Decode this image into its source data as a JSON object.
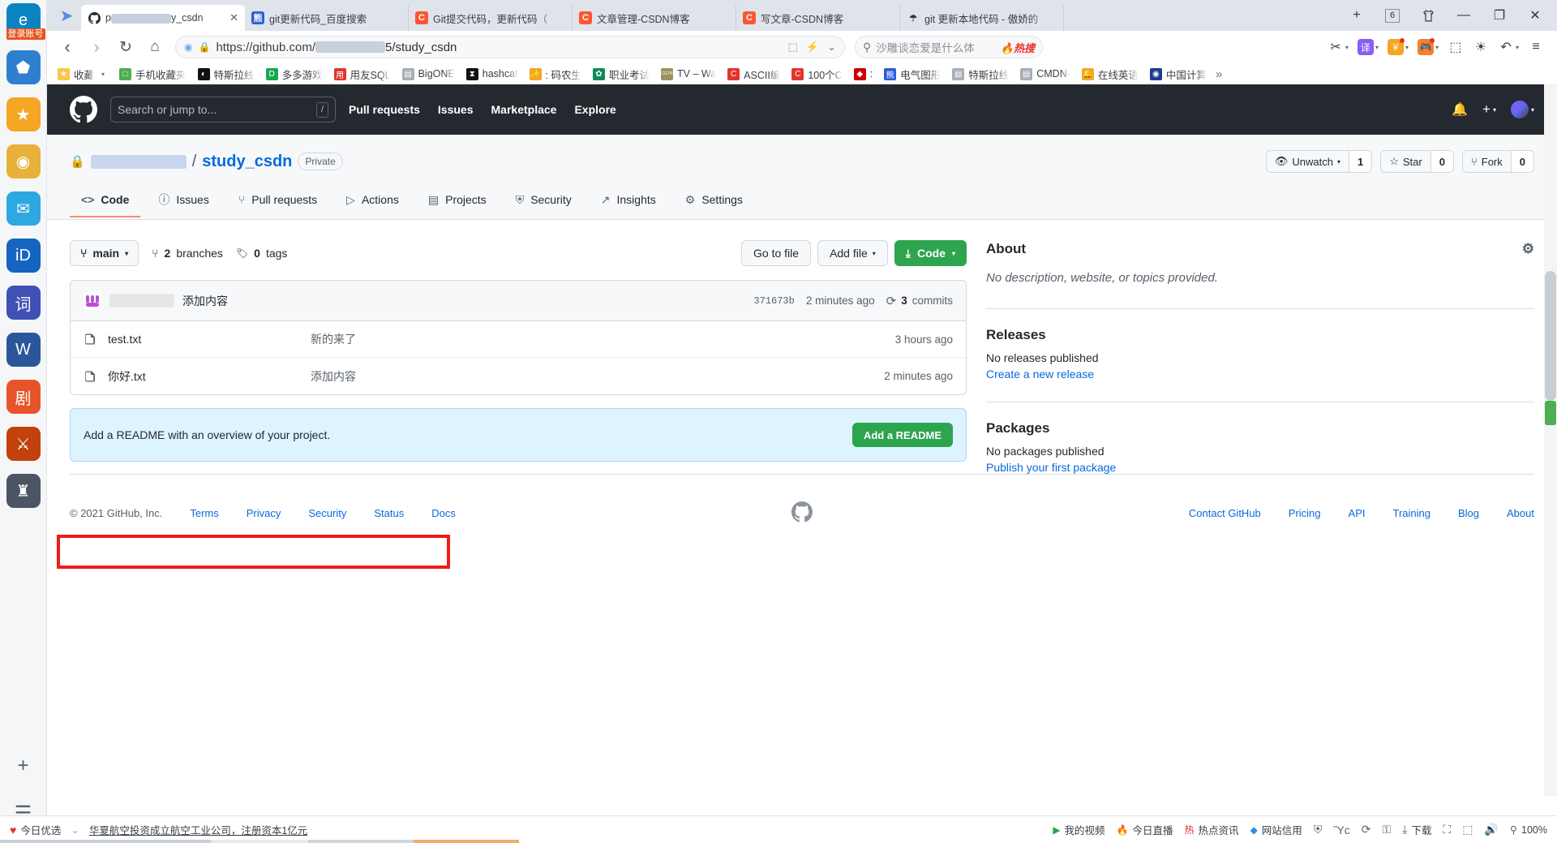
{
  "dock": {
    "items": [
      {
        "name": "ie-browser",
        "glyph": "e",
        "color": "#0a84c1",
        "badge": "登录账号"
      },
      {
        "name": "app-blue-doc",
        "glyph": "⬟",
        "color": "#2f7fd1",
        "badge": ""
      },
      {
        "name": "favorites-star",
        "glyph": "★",
        "color": "#f5a623",
        "badge": ""
      },
      {
        "name": "app-eye",
        "glyph": "◉",
        "color": "#e8b13a",
        "badge": ""
      },
      {
        "name": "mail-app",
        "glyph": "✉",
        "color": "#2da8e0",
        "badge": ""
      },
      {
        "name": "app-id-card",
        "glyph": "iD",
        "color": "#1565c0",
        "badge": ""
      },
      {
        "name": "app-dictionary",
        "glyph": "词",
        "color": "#3f51b5",
        "badge": ""
      },
      {
        "name": "word-app",
        "glyph": "W",
        "color": "#2b579a",
        "badge": ""
      },
      {
        "name": "app-orange-1",
        "glyph": "剧",
        "color": "#e8542a",
        "badge": ""
      },
      {
        "name": "game-app-1",
        "glyph": "⚔",
        "color": "#c2410c",
        "badge": ""
      },
      {
        "name": "game-app-2",
        "glyph": "♜",
        "color": "#4b5563",
        "badge": ""
      }
    ],
    "add_label": "+",
    "list_label": "☰"
  },
  "browser": {
    "nav_arrow": "➤",
    "tabs": [
      {
        "name": "tab-github",
        "favicon": "gh",
        "favicon_color": "#24292f",
        "favicon_glyph": "●",
        "label_prefix": "p",
        "label_suffix": "y_csdn",
        "active": true,
        "closable": true
      },
      {
        "name": "tab-baidu-git",
        "favicon_color": "#2b5fd9",
        "favicon_glyph": "熊",
        "label": "git更新代码_百度搜索",
        "active": false
      },
      {
        "name": "tab-csdn-commit",
        "favicon_color": "#fc5531",
        "favicon_glyph": "C",
        "label": "Git提交代码，更新代码（",
        "active": false
      },
      {
        "name": "tab-csdn-manage",
        "favicon_color": "#fc5531",
        "favicon_glyph": "C",
        "label": "文章管理-CSDN博客",
        "active": false
      },
      {
        "name": "tab-csdn-write",
        "favicon_color": "#fc5531",
        "favicon_glyph": "C",
        "label": "写文章-CSDN博客",
        "active": false
      },
      {
        "name": "tab-git-local",
        "favicon_color": "#ffffff",
        "favicon_glyph": "☂",
        "label": "git 更新本地代码 - 傲娇的",
        "active": false
      }
    ],
    "new_tab_label": "+",
    "tab_count": "6",
    "tshirt_icon": "ᵗ",
    "minimize": "—",
    "maximize": "❐",
    "close": "✕",
    "nav": {
      "back": "‹",
      "forward": "›",
      "reload": "↻",
      "home": "⌂"
    },
    "address": {
      "url_scheme": "https://github.com/",
      "url_tail": "5/study_csdn",
      "lock_icon": "🔒",
      "qr_icon": "⬚",
      "lightning_icon": "⚡",
      "chevron_icon": "⌄"
    },
    "search": {
      "icon": "⚲",
      "value": "沙雕谈恋爱是什么体",
      "hot_label": "热搜",
      "hot_icon": "🔥"
    },
    "toolbar_right": [
      {
        "name": "screenshot-tool",
        "glyph": "✂",
        "color": "transparent",
        "text_color": "#3c4043",
        "caret": true
      },
      {
        "name": "translate-tool",
        "glyph": "译",
        "color": "#8b5cf6",
        "text_color": "#fff",
        "caret": true
      },
      {
        "name": "coupon-tool",
        "glyph": "¥",
        "color": "#f5a623",
        "text_color": "#fff",
        "caret": true,
        "dot": true
      },
      {
        "name": "game-tool",
        "glyph": "🎮",
        "color": "#f5812f",
        "text_color": "#fff",
        "caret": true,
        "dot": true
      },
      {
        "name": "apps-grid",
        "glyph": "⬚",
        "color": "transparent",
        "text_color": "#3c4043",
        "caret": false
      },
      {
        "name": "theme-toggle",
        "glyph": "☀",
        "color": "transparent",
        "text_color": "#3c4043",
        "caret": false
      },
      {
        "name": "history-undo",
        "glyph": "↶",
        "color": "transparent",
        "text_color": "#3c4043",
        "caret": true
      },
      {
        "name": "main-menu",
        "glyph": "≡",
        "color": "transparent",
        "text_color": "#3c4043",
        "caret": false
      }
    ],
    "bookmarks": [
      {
        "name": "bookmark-favorites",
        "label": "收藏",
        "glyph": "★",
        "color": "#f7c948",
        "caret": true
      },
      {
        "name": "bookmark-mobile-favorites",
        "label": "手机收藏夹",
        "glyph": "□",
        "color": "#4caf50"
      },
      {
        "name": "bookmark-tesla",
        "label": "特斯拉线",
        "glyph": "◐",
        "color": "#111111"
      },
      {
        "name": "bookmark-duoduo-game",
        "label": "多多游戏",
        "glyph": "D",
        "color": "#17a84d"
      },
      {
        "name": "bookmark-yongyou-sql",
        "label": "用友SQL",
        "glyph": "用",
        "color": "#e3342f"
      },
      {
        "name": "bookmark-bigone",
        "label": "BigONE",
        "glyph": "▤",
        "color": "#a8aeb6"
      },
      {
        "name": "bookmark-hashcat",
        "label": "hashcat",
        "glyph": "⧗",
        "color": "#111111"
      },
      {
        "name": "bookmark-manong",
        "label": ": 码农生",
        "glyph": "✨",
        "color": "#f5a623"
      },
      {
        "name": "bookmark-zhiye",
        "label": "职业考试",
        "glyph": "✿",
        "color": "#0f8b5a"
      },
      {
        "name": "bookmark-cgtn-tv",
        "label": "TV – Wa",
        "glyph": "CGTN",
        "color": "#9a9260"
      },
      {
        "name": "bookmark-ascii",
        "label": "ASCII编",
        "glyph": "C",
        "color": "#e3342f"
      },
      {
        "name": "bookmark-100c",
        "label": "100个C",
        "glyph": "C",
        "color": "#e3342f"
      },
      {
        "name": "bookmark-ruby",
        "label": ":",
        "glyph": "◆",
        "color": "#cc0000"
      },
      {
        "name": "bookmark-dianqi",
        "label": "电气图形",
        "glyph": "熊",
        "color": "#2b5fd9"
      },
      {
        "name": "bookmark-tesla2",
        "label": "特斯拉线",
        "glyph": "▤",
        "color": "#a8aeb6"
      },
      {
        "name": "bookmark-cmdn",
        "label": "CMDN-",
        "glyph": "▤",
        "color": "#a8aeb6"
      },
      {
        "name": "bookmark-online-english",
        "label": "在线英语",
        "glyph": "🔔",
        "color": "#f5a623"
      },
      {
        "name": "bookmark-china-computing",
        "label": "中国计算",
        "glyph": "◉",
        "color": "#1f3a93"
      }
    ],
    "bookmarks_overflow": "»"
  },
  "github": {
    "header": {
      "search_placeholder": "Search or jump to...",
      "search_slash": "/",
      "nav": [
        {
          "name": "gh-nav-pull-requests",
          "label": "Pull requests"
        },
        {
          "name": "gh-nav-issues",
          "label": "Issues"
        },
        {
          "name": "gh-nav-marketplace",
          "label": "Marketplace"
        },
        {
          "name": "gh-nav-explore",
          "label": "Explore"
        }
      ],
      "bell_icon": "🔔",
      "plus_label": "+",
      "caret": "▾"
    },
    "repo": {
      "lock_icon": "🔒",
      "owner": "",
      "separator": "/",
      "name": "study_csdn",
      "visibility": "Private",
      "watch": {
        "label": "Unwatch",
        "count": "1",
        "icon": "👁",
        "caret": "▾"
      },
      "star": {
        "label": "Star",
        "count": "0",
        "icon": "☆"
      },
      "fork": {
        "label": "Fork",
        "count": "0",
        "icon": "⑂"
      }
    },
    "tabs": [
      {
        "name": "tab-code",
        "label": "Code",
        "icon": "<>",
        "active": true
      },
      {
        "name": "tab-issues",
        "label": "Issues",
        "icon": "ⓘ",
        "active": false
      },
      {
        "name": "tab-pull-requests",
        "label": "Pull requests",
        "icon": "⑂",
        "active": false
      },
      {
        "name": "tab-actions",
        "label": "Actions",
        "icon": "▷",
        "active": false
      },
      {
        "name": "tab-projects",
        "label": "Projects",
        "icon": "▤",
        "active": false
      },
      {
        "name": "tab-security",
        "label": "Security",
        "icon": "⛨",
        "active": false
      },
      {
        "name": "tab-insights",
        "label": "Insights",
        "icon": "↗",
        "active": false
      },
      {
        "name": "tab-settings",
        "label": "Settings",
        "icon": "⚙",
        "active": false
      }
    ],
    "branch_bar": {
      "branch_icon": "⑂",
      "branch_name": "main",
      "branch_caret": "▾",
      "branches_count": "2",
      "branches_label": "branches",
      "tags_icon": "🏷",
      "tags_count": "0",
      "tags_label": "tags",
      "go_to_file": "Go to file",
      "add_file": "Add file",
      "add_file_caret": "▾",
      "code_label": "Code",
      "code_icon": "⤓",
      "code_caret": "▾"
    },
    "latest_commit": {
      "message": "添加内容",
      "sha": "371673b",
      "time": "2 minutes ago",
      "commits_count": "3",
      "commits_label": "commits",
      "history_icon": "⟳"
    },
    "files": [
      {
        "name": "test.txt",
        "message": "新的来了",
        "time": "3 hours ago",
        "highlighted": false
      },
      {
        "name": "你好.txt",
        "message": "添加内容",
        "time": "2 minutes ago",
        "highlighted": true
      }
    ],
    "readme_prompt": {
      "text": "Add a README with an overview of your project.",
      "button": "Add a README"
    },
    "sidebar": {
      "about_title": "About",
      "gear_icon": "⚙",
      "about_text": "No description, website, or topics provided.",
      "releases_title": "Releases",
      "releases_text": "No releases published",
      "releases_link": "Create a new release",
      "packages_title": "Packages",
      "packages_text": "No packages published",
      "packages_link": "Publish your first package"
    },
    "footer": {
      "copyright": "© 2021 GitHub, Inc.",
      "left_links": [
        "Terms",
        "Privacy",
        "Security",
        "Status",
        "Docs"
      ],
      "right_links": [
        "Contact GitHub",
        "Pricing",
        "API",
        "Training",
        "Blog",
        "About"
      ]
    }
  },
  "statusbar": {
    "today_label": "今日优选",
    "today_icon": "♥",
    "collapse_icon": "⌄",
    "news": "华夏航空投资成立航空工业公司，注册资本1亿元",
    "right_items": [
      {
        "name": "my-video",
        "label": "我的视频",
        "glyph": "▶",
        "color": "#2da44e"
      },
      {
        "name": "today-live",
        "label": "今日直播",
        "glyph": "🔥",
        "color": "#e8542a"
      },
      {
        "name": "hot-news",
        "label": "热点资讯",
        "glyph": "热",
        "color": "#e3342f"
      },
      {
        "name": "site-credit",
        "label": "网站信用",
        "glyph": "◆",
        "color": "#2b8fe0"
      }
    ],
    "icons": [
      {
        "name": "shield-icon",
        "glyph": "⛨"
      },
      {
        "name": "image-icon",
        "glyph": "Ὓc"
      },
      {
        "name": "mouse-gesture-icon",
        "glyph": "⟳"
      },
      {
        "name": "plugin-icon",
        "glyph": "⚿"
      },
      {
        "name": "download-icon",
        "glyph": "⤓",
        "label": "下载"
      },
      {
        "name": "fullscreen-icon",
        "glyph": "⛶"
      },
      {
        "name": "reading-mode-icon",
        "glyph": "⬚"
      },
      {
        "name": "sound-icon",
        "glyph": "🔊"
      }
    ],
    "zoom": "100%",
    "zoom_icon": "⚲"
  }
}
